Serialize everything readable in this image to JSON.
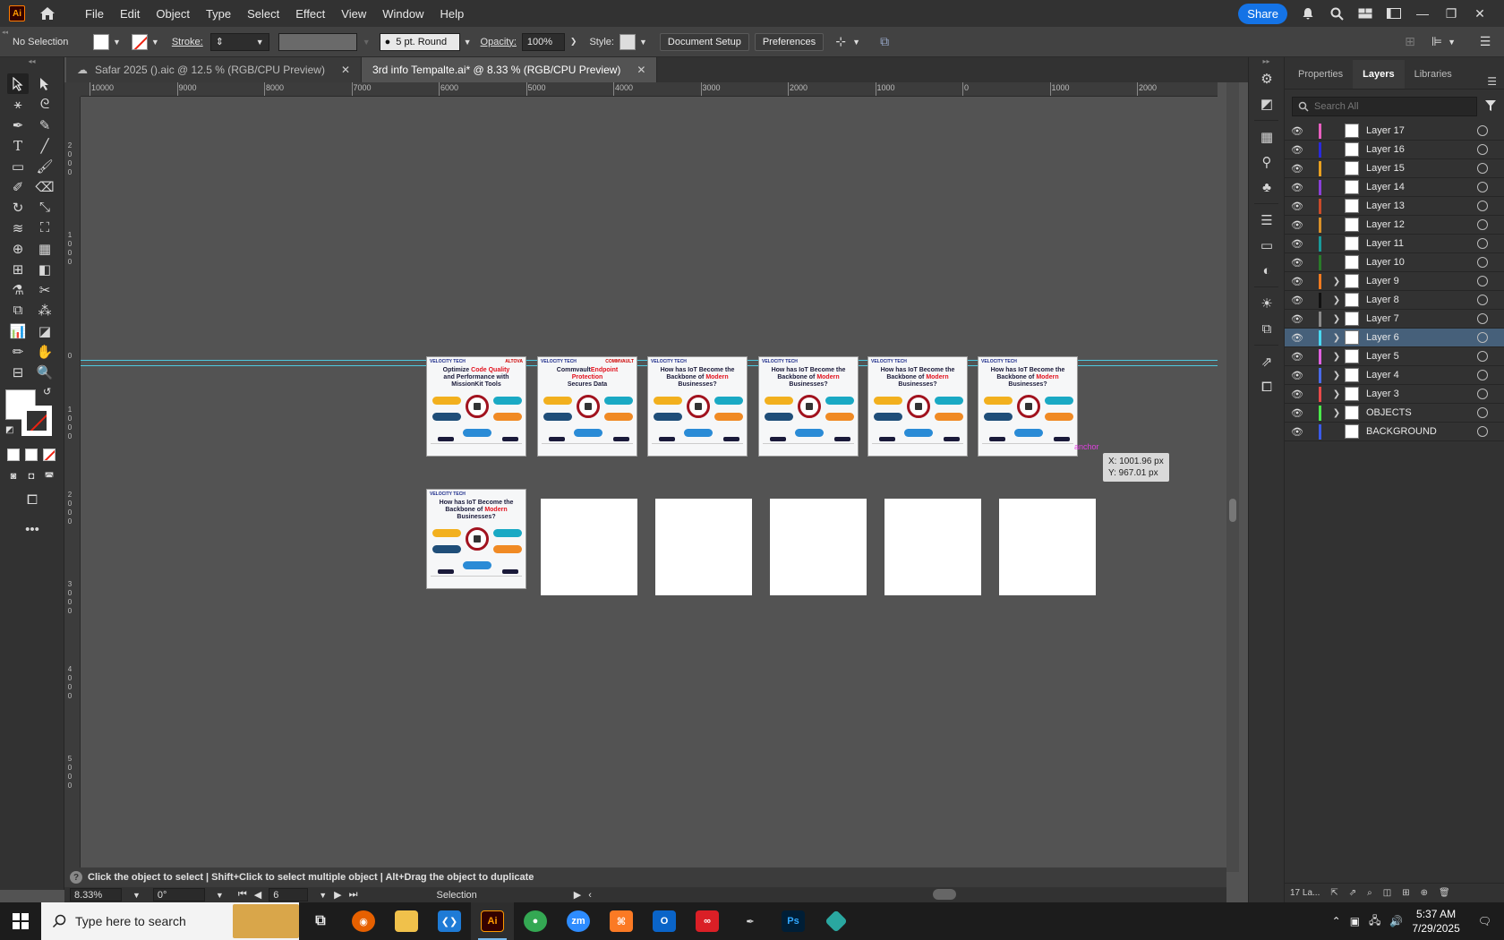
{
  "menubar": {
    "items": [
      "File",
      "Edit",
      "Object",
      "Type",
      "Select",
      "Effect",
      "View",
      "Window",
      "Help"
    ],
    "share_label": "Share"
  },
  "control": {
    "selection": "No Selection",
    "stroke_label": "Stroke:",
    "brush": "5 pt. Round",
    "opacity_label": "Opacity:",
    "opacity_value": "100%",
    "style_label": "Style:",
    "document_setup": "Document Setup",
    "preferences": "Preferences"
  },
  "tabs": [
    {
      "label": "Safar 2025 ().aic @ 12.5 % (RGB/CPU Preview)",
      "active": false
    },
    {
      "label": "3rd info Tempalte.ai* @ 8.33 % (RGB/CPU Preview)",
      "active": true
    }
  ],
  "ruler": {
    "h_labels": [
      "10000",
      "9000",
      "8000",
      "7000",
      "6000",
      "5000",
      "4000",
      "3000",
      "2000",
      "1000",
      "0",
      "1000",
      "2000"
    ],
    "v_labels": [
      "2\n0\n0\n0",
      "1\n0\n0\n0",
      "0",
      "1\n0\n0\n0",
      "2\n0\n0\n0",
      "3\n0\n0\n0",
      "4\n0\n0\n0",
      "5\n0\n0\n0"
    ]
  },
  "artboards": [
    {
      "brand": "VELOCITY TECH",
      "partner": "ALTOVA",
      "title_plain": "Optimize ",
      "title_red": "Code Quality",
      "title_line2": "and Performance with MissionKit Tools"
    },
    {
      "brand": "VELOCITY TECH",
      "partner": "COMMVAULT",
      "title_plain": "Commvault",
      "title_red": "Endpoint Protection",
      "title_line2": "Secures Data"
    },
    {
      "brand": "VELOCITY TECH",
      "partner": "",
      "title_plain": "How has IoT Become the Backbone of ",
      "title_red": "Modern",
      "title_line2": "Businesses?"
    },
    {
      "brand": "VELOCITY TECH",
      "partner": "",
      "title_plain": "How has IoT Become the Backbone of ",
      "title_red": "Modern",
      "title_line2": "Businesses?"
    },
    {
      "brand": "VELOCITY TECH",
      "partner": "",
      "title_plain": "How has IoT Become the Backbone of ",
      "title_red": "Modern",
      "title_line2": "Businesses?"
    },
    {
      "brand": "VELOCITY TECH",
      "partner": "",
      "title_plain": "How has IoT Become the Backbone of ",
      "title_red": "Modern",
      "title_line2": "Businesses?"
    },
    {
      "brand": "VELOCITY TECH",
      "partner": "",
      "title_plain": "How has IoT Become the Backbone of ",
      "title_red": "Modern",
      "title_line2": "Businesses?"
    }
  ],
  "canvas": {
    "anchor_label": "anchor",
    "coord_x": "X: 1001.96 px",
    "coord_y": "Y: 967.01 px"
  },
  "hint": {
    "text": "Click the object to select  |  Shift+Click to select multiple object  |  Alt+Drag the object to duplicate"
  },
  "status": {
    "zoom": "8.33%",
    "rotation": "0°",
    "artboard_number": "6",
    "tool": "Selection"
  },
  "panel": {
    "tabs": [
      "Properties",
      "Layers",
      "Libraries"
    ],
    "active_tab": "Layers",
    "search_placeholder": "Search All",
    "layers": [
      {
        "name": "Layer 17",
        "color": "#e85fc0",
        "expandable": false,
        "selected": false
      },
      {
        "name": "Layer 16",
        "color": "#2a2adc",
        "expandable": false,
        "selected": false
      },
      {
        "name": "Layer 15",
        "color": "#e8a020",
        "expandable": false,
        "selected": false
      },
      {
        "name": "Layer 14",
        "color": "#8a40d8",
        "expandable": false,
        "selected": false
      },
      {
        "name": "Layer 13",
        "color": "#c84a2a",
        "expandable": false,
        "selected": false
      },
      {
        "name": "Layer 12",
        "color": "#d8902a",
        "expandable": false,
        "selected": false
      },
      {
        "name": "Layer 11",
        "color": "#1a9a9a",
        "expandable": false,
        "selected": false
      },
      {
        "name": "Layer 10",
        "color": "#2a7a2a",
        "expandable": false,
        "selected": false
      },
      {
        "name": "Layer 9",
        "color": "#f07a20",
        "expandable": true,
        "selected": false
      },
      {
        "name": "Layer 8",
        "color": "#111111",
        "expandable": true,
        "selected": false
      },
      {
        "name": "Layer 7",
        "color": "#8a8a8a",
        "expandable": true,
        "selected": false
      },
      {
        "name": "Layer 6",
        "color": "#4ad8f0",
        "expandable": true,
        "selected": true
      },
      {
        "name": "Layer 5",
        "color": "#e060e0",
        "expandable": true,
        "selected": false
      },
      {
        "name": "Layer 4",
        "color": "#4a6ae8",
        "expandable": true,
        "selected": false
      },
      {
        "name": "Layer 3",
        "color": "#e84a4a",
        "expandable": true,
        "selected": false
      },
      {
        "name": "OBJECTS",
        "color": "#4ae84a",
        "expandable": true,
        "selected": false
      },
      {
        "name": "BACKGROUND",
        "color": "#3a5ae8",
        "expandable": false,
        "selected": false
      }
    ],
    "footer_count": "17 La..."
  },
  "taskbar": {
    "search_placeholder": "Type here to search",
    "time": "5:37 AM",
    "date": "7/29/2025"
  }
}
